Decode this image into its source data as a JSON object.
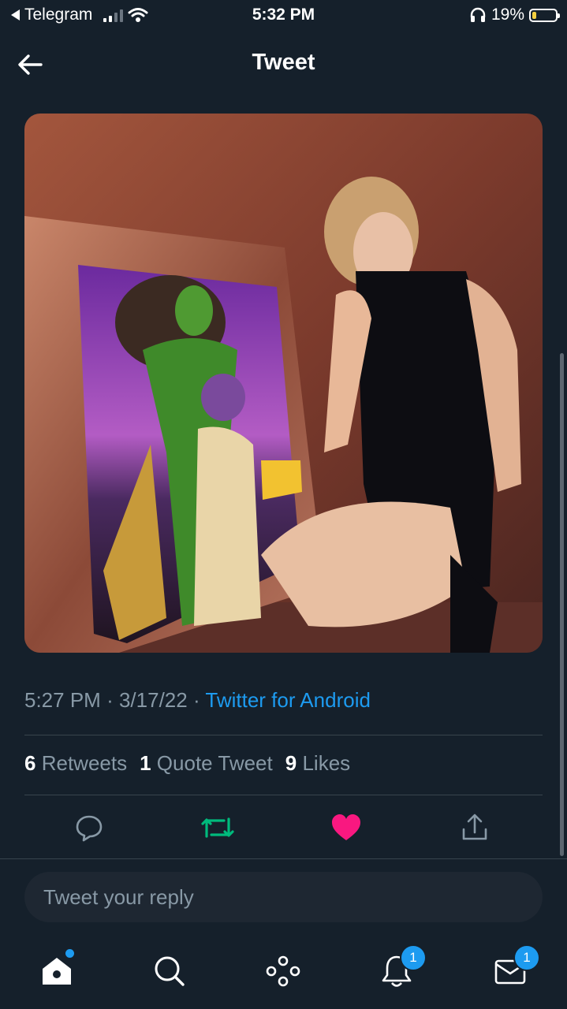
{
  "status_bar": {
    "back_app": "Telegram",
    "time": "5:32 PM",
    "battery": "19%"
  },
  "header": {
    "title": "Tweet"
  },
  "media": {
    "description_icon": "photo"
  },
  "meta": {
    "time": "5:27 PM",
    "date": "3/17/22",
    "source": "Twitter for Android",
    "sep": "·"
  },
  "stats": {
    "retweets_count": "6",
    "retweets_label": "Retweets",
    "quotes_count": "1",
    "quotes_label": "Quote Tweet",
    "likes_count": "9",
    "likes_label": "Likes"
  },
  "actions": {
    "reply_icon": "reply-icon",
    "retweet_icon": "retweet-icon",
    "like_icon": "heart-icon",
    "share_icon": "share-icon",
    "colors": {
      "retweet": "#00ba7c",
      "like": "#f91880",
      "default": "#8899a6"
    }
  },
  "reply_box": {
    "placeholder": "Tweet your reply"
  },
  "tabbar": {
    "notifications_badge": "1",
    "messages_badge": "1"
  }
}
